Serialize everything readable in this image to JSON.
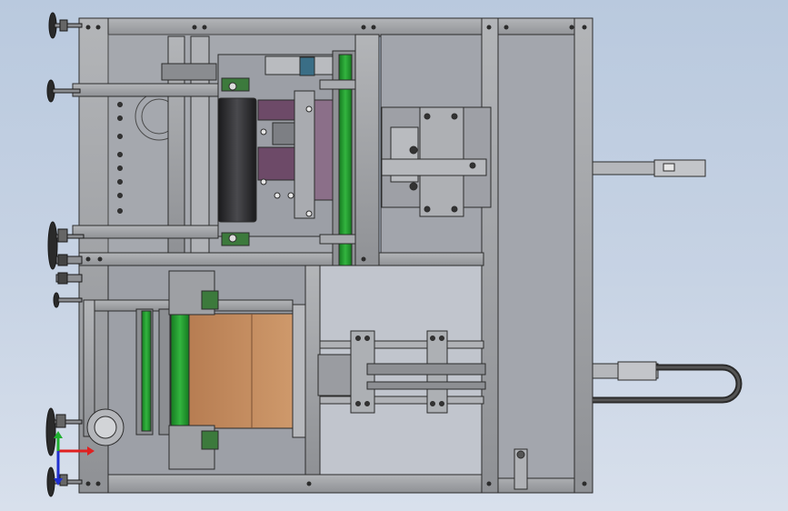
{
  "view": {
    "background_top": "#b9c9de",
    "background_bottom": "#d8e0ec",
    "frame_color": "#9ea0a3",
    "panel_color": "#a3a6ad",
    "belt_color": "#1e8f2a",
    "box_color": "#c48a5c",
    "roller_color": "#2d2d2f",
    "magenta_parts_color": "#6d4a68",
    "outline_color": "#2c2c2c"
  },
  "triad": {
    "x_axis_color": "#e02020",
    "y_axis_color": "#20b030",
    "z_axis_color": "#2030d0"
  },
  "icons": [
    "leveling-foot-icon",
    "coordinate-triad-icon",
    "bolt-icon"
  ]
}
